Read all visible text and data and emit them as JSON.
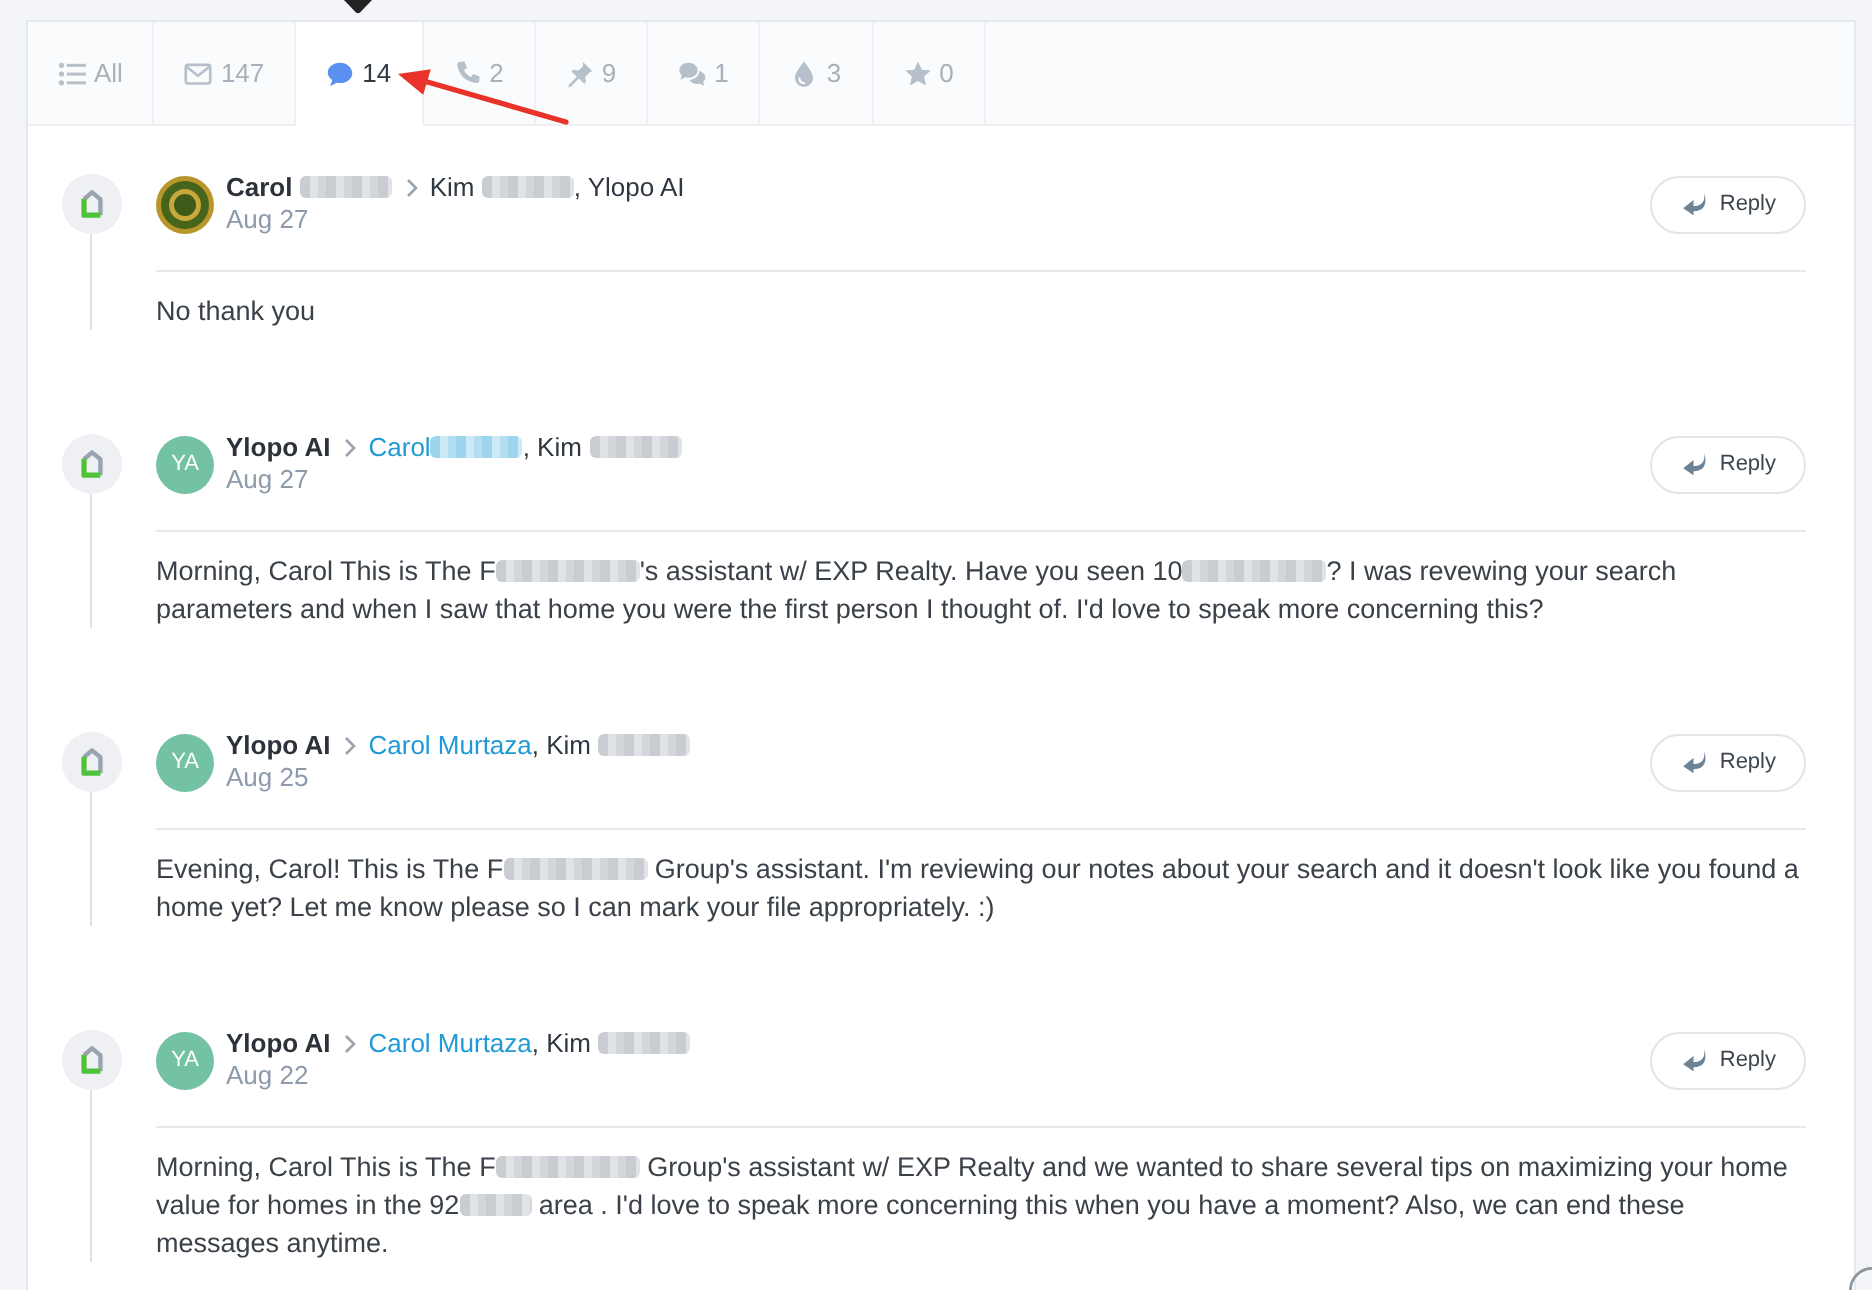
{
  "tabs": [
    {
      "label": "All",
      "selected": false,
      "tooltip_shown": false
    },
    {
      "label": "147",
      "selected": false,
      "tooltip_shown": false
    },
    {
      "label": "14",
      "selected": true,
      "tooltip_shown": true
    },
    {
      "label": "2",
      "selected": false,
      "tooltip_shown": false
    },
    {
      "label": "9",
      "selected": false,
      "tooltip_shown": false
    },
    {
      "label": "1",
      "selected": false,
      "tooltip_shown": false
    },
    {
      "label": "3",
      "selected": false,
      "tooltip_shown": false
    },
    {
      "label": "0",
      "selected": false,
      "tooltip_shown": false
    }
  ],
  "messages": [
    {
      "avatar": {
        "kind": "logo"
      },
      "sender": [
        {
          "kind": "text",
          "text": "Carol "
        },
        {
          "kind": "blur"
        }
      ],
      "recipients": [
        {
          "kind": "text",
          "text": "Kim "
        },
        {
          "kind": "blur"
        },
        {
          "kind": "text",
          "text": ", Ylopo AI"
        }
      ],
      "date": "Aug 27",
      "reply_label": "Reply",
      "body": [
        {
          "kind": "text",
          "text": "No thank you"
        }
      ]
    },
    {
      "avatar": {
        "kind": "initials",
        "text": "YA"
      },
      "sender": [
        {
          "kind": "text",
          "text": "Ylopo AI"
        }
      ],
      "recipients": [
        {
          "kind": "link",
          "text": "Carol"
        },
        {
          "kind": "blur_link"
        },
        {
          "kind": "text",
          "text": ", Kim "
        },
        {
          "kind": "blur"
        }
      ],
      "date": "Aug 27",
      "reply_label": "Reply",
      "body": [
        {
          "kind": "text",
          "text": "Morning, Carol This is The F"
        },
        {
          "kind": "blur_long"
        },
        {
          "kind": "text",
          "text": "'s assistant w/ EXP Realty. Have you seen 10"
        },
        {
          "kind": "blur_long"
        },
        {
          "kind": "text",
          "text": "? I was revewing your search parameters and when I saw that home you were the first person I thought of. I'd love to speak more concerning this?"
        }
      ]
    },
    {
      "avatar": {
        "kind": "initials",
        "text": "YA"
      },
      "sender": [
        {
          "kind": "text",
          "text": "Ylopo AI"
        }
      ],
      "recipients": [
        {
          "kind": "link",
          "text": "Carol Murtaza"
        },
        {
          "kind": "text",
          "text": ", Kim "
        },
        {
          "kind": "blur"
        }
      ],
      "date": "Aug 25",
      "reply_label": "Reply",
      "body": [
        {
          "kind": "text",
          "text": "Evening, Carol! This is The F"
        },
        {
          "kind": "blur_long"
        },
        {
          "kind": "text",
          "text": " Group's assistant. I'm reviewing our notes about your search and it doesn't look like you found a home yet? Let me know please so I can mark your file appropriately. :)"
        }
      ]
    },
    {
      "avatar": {
        "kind": "initials",
        "text": "YA"
      },
      "sender": [
        {
          "kind": "text",
          "text": "Ylopo AI"
        }
      ],
      "recipients": [
        {
          "kind": "link",
          "text": "Carol Murtaza"
        },
        {
          "kind": "text",
          "text": ", Kim "
        },
        {
          "kind": "blur"
        }
      ],
      "date": "Aug 22",
      "reply_label": "Reply",
      "body": [
        {
          "kind": "text",
          "text": "Morning, Carol This is The F"
        },
        {
          "kind": "blur_long"
        },
        {
          "kind": "text",
          "text": " Group's assistant w/ EXP Realty and we wanted to share several tips on maximizing your home value for homes in the 92"
        },
        {
          "kind": "blur_short"
        },
        {
          "kind": "text",
          "text": " area . I'd love to speak more concerning this when you have a moment? Also, we can end these messages anytime."
        }
      ]
    }
  ]
}
